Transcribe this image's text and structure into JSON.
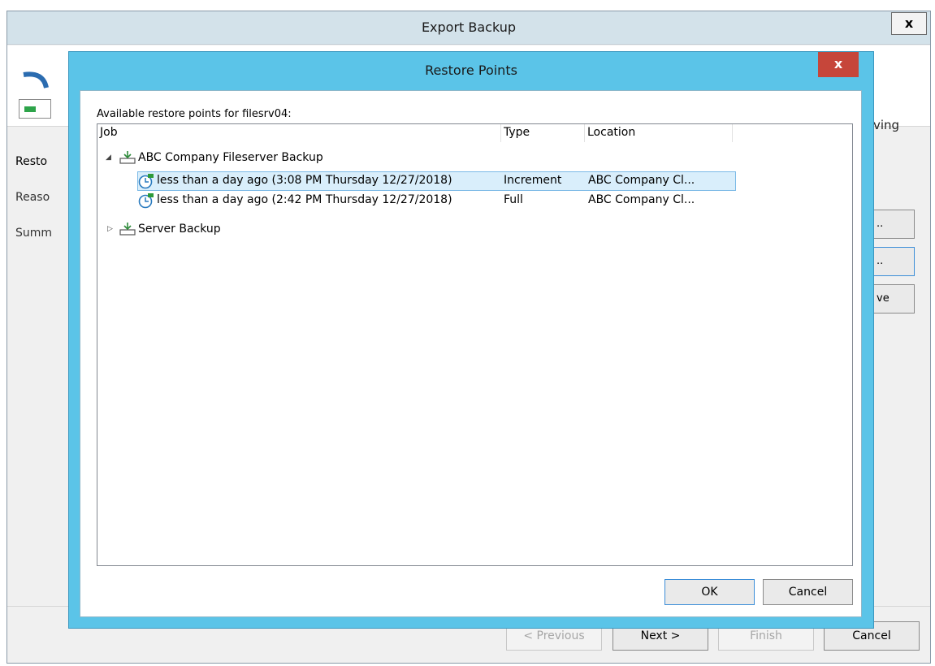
{
  "outer": {
    "title": "Export Backup",
    "close_label": "x",
    "desc_fragment": "ving",
    "steps": [
      "Resto",
      "Reaso",
      "Summ"
    ],
    "side_buttons": [
      "..",
      "..",
      "ve"
    ],
    "footer": {
      "previous": "< Previous",
      "next": "Next >",
      "finish": "Finish",
      "cancel": "Cancel"
    }
  },
  "modal": {
    "title": "Restore Points",
    "close_label": "x",
    "available_label": "Available restore points for filesrv04:",
    "columns": [
      "Job",
      "Type",
      "Location"
    ],
    "rows": [
      {
        "label": "ABC Company Fileserver Backup",
        "type": "",
        "location": "",
        "expander": "◢"
      },
      {
        "label": "less than a day ago (3:08 PM Thursday 12/27/2018)",
        "type": "Increment",
        "location": "ABC Company Cl...",
        "selected": true
      },
      {
        "label": "less than a day ago (2:42 PM Thursday 12/27/2018)",
        "type": "Full",
        "location": "ABC Company Cl..."
      },
      {
        "label": "Server Backup",
        "type": "",
        "location": "",
        "expander": "▷"
      }
    ],
    "ok": "OK",
    "cancel": "Cancel"
  }
}
